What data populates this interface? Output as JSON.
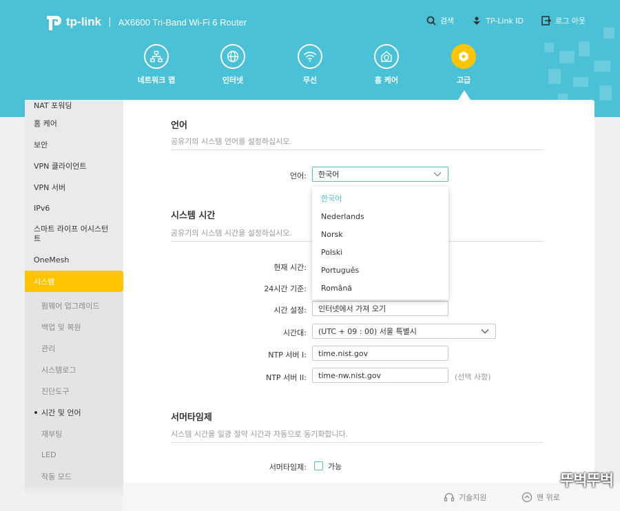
{
  "header": {
    "brand": "tp-link",
    "model": "AX6600 Tri-Band Wi-Fi 6 Router",
    "actions": [
      {
        "label": "검색",
        "icon": "search-icon"
      },
      {
        "label": "TP-Link ID",
        "icon": "user-id-icon"
      },
      {
        "label": "로그 아웃",
        "icon": "logout-icon"
      }
    ]
  },
  "nav": [
    {
      "label": "네트워크 맵",
      "icon": "network-map-icon"
    },
    {
      "label": "인터넷",
      "icon": "globe-icon"
    },
    {
      "label": "무선",
      "icon": "wifi-icon"
    },
    {
      "label": "홈 케어",
      "icon": "home-care-icon"
    },
    {
      "label": "고급",
      "icon": "gear-icon",
      "active": true
    }
  ],
  "sidebar": {
    "items": [
      "NAT 포워딩",
      "홈 케어",
      "보안",
      "VPN 클라이언트",
      "VPN 서버",
      "IPv6",
      "스마트 라이프 어시스턴트",
      "OneMesh",
      "시스템"
    ],
    "active": "시스템",
    "sub_items": [
      "펌웨어 업그레이드",
      "백업 및 복원",
      "관리",
      "시스템로그",
      "진단도구",
      "시간 및 언어",
      "재부팅",
      "LED",
      "작동 모드"
    ],
    "active_sub": "시간 및 언어"
  },
  "language": {
    "title": "언어",
    "desc": "공유기의 시스템 언어를 설정하십시오.",
    "label": "언어:",
    "value": "한국어",
    "options": [
      "한국어",
      "Nederlands",
      "Norsk",
      "Polski",
      "Português",
      "Română"
    ]
  },
  "system_time": {
    "title": "시스템 시간",
    "desc": "공유기의 시스템 시간을 설정하십시오.",
    "current_label": "현재 시간:",
    "hour24_label": "24시간 기준:",
    "set_label": "시간 설정:",
    "set_value": "인터넷에서 가져 오기",
    "tz_label": "시간대:",
    "tz_value": "(UTC + 09 : 00) 서울 특별시",
    "ntp1_label": "NTP 서버 I:",
    "ntp1_value": "time.nist.gov",
    "ntp2_label": "NTP 서버 II:",
    "ntp2_value": "time-nw.nist.gov",
    "ntp2_hint": "(선택 사항)"
  },
  "dst": {
    "title": "서머타임제",
    "desc": "시스템 시간을 일광 절약 시간과 자동으로 동기화합니다.",
    "label": "서머타임제:",
    "checkbox_label": "가능"
  },
  "footer": {
    "support": "기술지원",
    "back_to_top": "맨 위로"
  },
  "watermark": "뚜벅뚜벅"
}
